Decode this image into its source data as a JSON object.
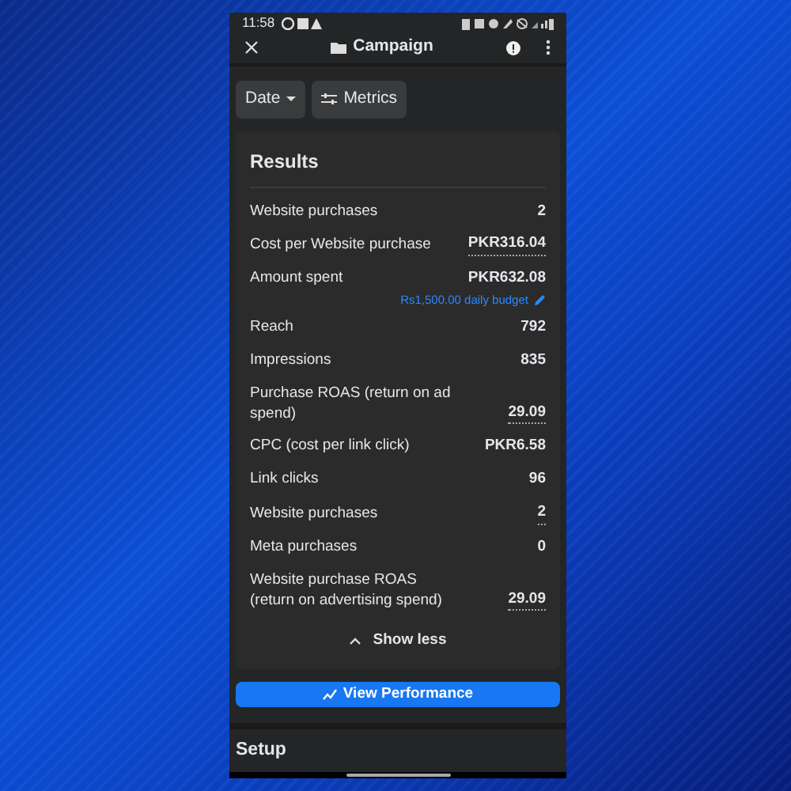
{
  "status_bar": {
    "time": "11:58"
  },
  "header": {
    "title": "Campaign"
  },
  "filters": [
    {
      "label": "Date",
      "kind": "dropdown"
    },
    {
      "label": "Metrics",
      "kind": "sliders"
    }
  ],
  "results": {
    "title": "Results",
    "rows": [
      {
        "label": "Website purchases",
        "value": "2",
        "underlined": false
      },
      {
        "label": "Cost per Website purchase",
        "value": "PKR316.04",
        "underlined": true
      },
      {
        "label": "Amount spent",
        "value": "PKR632.08",
        "underlined": false,
        "note": "Rs1,500.00 daily budget"
      },
      {
        "label": "Reach",
        "value": "792",
        "underlined": false
      },
      {
        "label": "Impressions",
        "value": "835",
        "underlined": false
      },
      {
        "label": "Purchase ROAS (return on ad spend)",
        "value": "29.09",
        "underlined": true
      },
      {
        "label": "CPC (cost per link click)",
        "value": "PKR6.58",
        "underlined": false
      },
      {
        "label": "Link clicks",
        "value": "96",
        "underlined": false
      },
      {
        "label": "Website purchases",
        "value": "2",
        "underlined": true
      },
      {
        "label": "Meta purchases",
        "value": "0",
        "underlined": false
      },
      {
        "label": "Website purchase ROAS (return on advertising spend)",
        "value": "29.09",
        "underlined": true
      }
    ],
    "toggle": "Show less"
  },
  "primary_button": "View Performance",
  "section_title": "Setup"
}
